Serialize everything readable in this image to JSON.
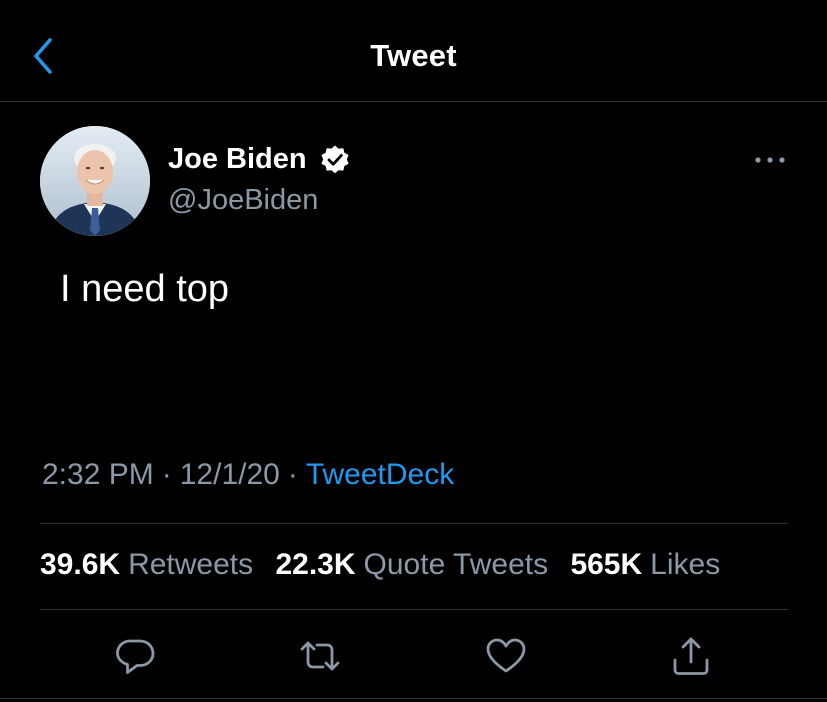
{
  "header": {
    "title": "Tweet",
    "back_icon": "chevron-left-icon"
  },
  "tweet": {
    "author": {
      "display_name": "Joe Biden",
      "handle": "@JoeBiden",
      "verified": true
    },
    "text": "I need top",
    "time": "2:32 PM",
    "date": "12/1/20",
    "separator": "·",
    "source": "TweetDeck"
  },
  "stats": {
    "retweets": {
      "count": "39.6K",
      "label": "Retweets"
    },
    "quote_tweets": {
      "count": "22.3K",
      "label": "Quote Tweets"
    },
    "likes": {
      "count": "565K",
      "label": "Likes"
    }
  },
  "actions": [
    "reply-icon",
    "retweet-icon",
    "like-icon",
    "share-icon"
  ],
  "colors": {
    "background": "#000000",
    "accent": "#1d9bf0",
    "secondary_text": "#8b98a5",
    "divider": "#2f3336",
    "primary_text": "#ffffff"
  }
}
